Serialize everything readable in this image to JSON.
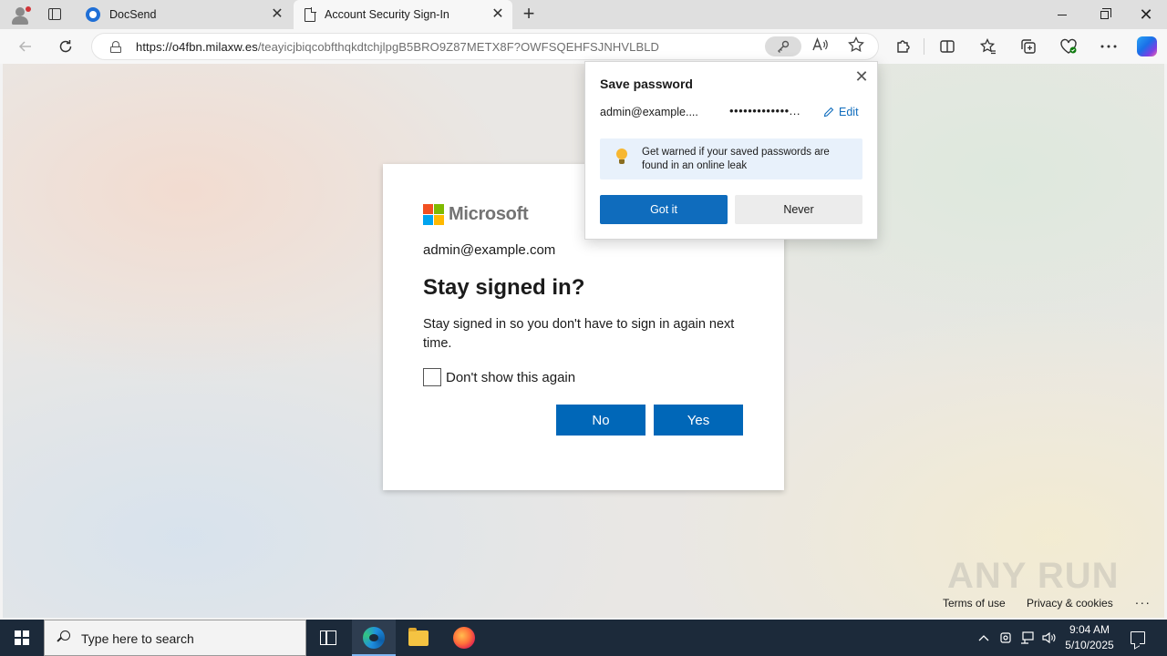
{
  "browser": {
    "tabs": [
      {
        "title": "DocSend",
        "icon": "docsend-favicon"
      },
      {
        "title": "Account Security Sign-In",
        "icon": "page-favicon",
        "active": true
      }
    ],
    "url_host": "https://o4fbn.milaxw.es",
    "url_path": "/teayicjbiqcobfthqkdtchjlpgB5BRO9Z87METX8F?OWFSQEHFSJNHVLBLD",
    "tab_close_glyph": "✕",
    "new_tab_glyph": "+",
    "window_close_glyph": "✕"
  },
  "signin": {
    "brand": "Microsoft",
    "email": "admin@example.com",
    "title": "Stay signed in?",
    "description": "Stay signed in so you don't have to sign in again next time.",
    "checkbox_label": "Don't show this again",
    "no_label": "No",
    "yes_label": "Yes"
  },
  "footer": {
    "terms": "Terms of use",
    "privacy": "Privacy & cookies",
    "more": "...",
    "watermark": "ANY RUN"
  },
  "password_popup": {
    "title": "Save password",
    "username": "admin@example....",
    "password_mask": "•••••••••••••...",
    "edit_label": "Edit",
    "tip": "Get warned if your saved passwords are found in an online leak",
    "got_it_label": "Got it",
    "never_label": "Never",
    "close_glyph": "✕"
  },
  "taskbar": {
    "search_placeholder": "Type here to search",
    "time": "9:04 AM",
    "date": "5/10/2025"
  },
  "colors": {
    "microsoft_blue": "#0067b8",
    "edge_blue": "#0f6cbd",
    "taskbar": "#1c2a3a"
  }
}
